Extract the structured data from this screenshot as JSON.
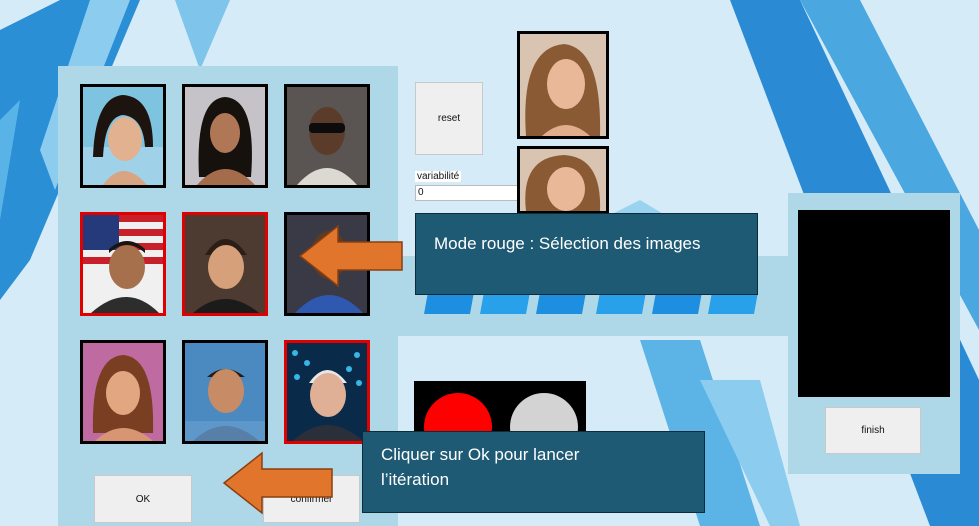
{
  "buttons": {
    "reset": "reset",
    "ok": "OK",
    "confirm": "confirmer",
    "finish": "finish"
  },
  "variability": {
    "label": "variabilité",
    "value": "0"
  },
  "callouts": {
    "red_mode": "Mode rouge : Sélection des images",
    "click_ok": "Cliquer sur Ok pour lancer l’itération"
  },
  "grid": [
    {
      "selected": false
    },
    {
      "selected": false
    },
    {
      "selected": false
    },
    {
      "selected": true
    },
    {
      "selected": true
    },
    {
      "selected": false
    },
    {
      "selected": false
    },
    {
      "selected": false
    },
    {
      "selected": true
    }
  ],
  "indicators": {
    "left_light_color": "#ff0000",
    "right_light_color": "#d3d3d3"
  },
  "colors": {
    "panel": "#aed8e8",
    "callout": "#1e5a74",
    "arrow": "#e2752c",
    "selected_border": "#e00000"
  }
}
